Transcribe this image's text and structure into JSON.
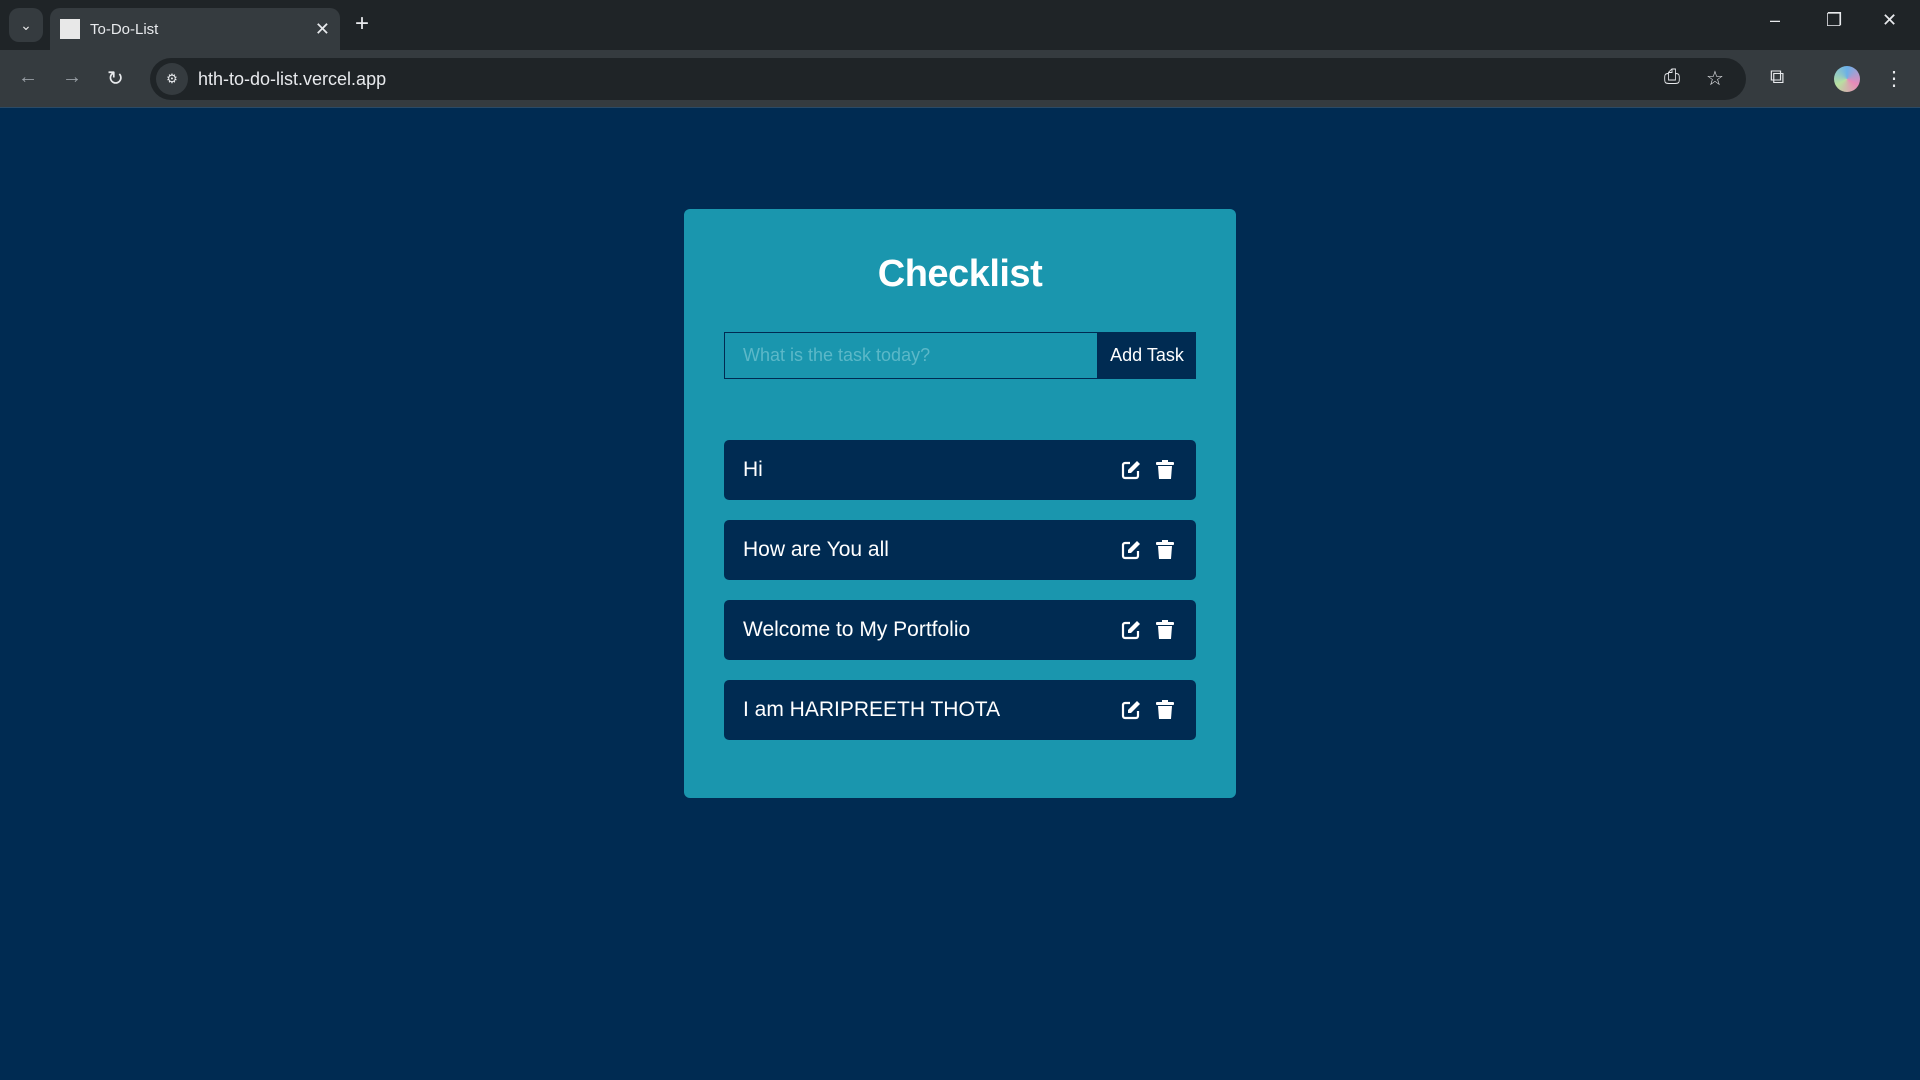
{
  "browser": {
    "tab_title": "To-Do-List",
    "url": "hth-to-do-list.vercel.app"
  },
  "app": {
    "title": "Checklist",
    "input": {
      "placeholder": "What is the task today?",
      "value": ""
    },
    "add_button": "Add Task",
    "tasks": [
      {
        "text": "Hi"
      },
      {
        "text": "How are You all"
      },
      {
        "text": "Welcome to My Portfolio"
      },
      {
        "text": "I am HARIPREETH THOTA"
      }
    ]
  },
  "colors": {
    "background": "#002b52",
    "card": "#1a96ae",
    "item": "#002b52"
  }
}
